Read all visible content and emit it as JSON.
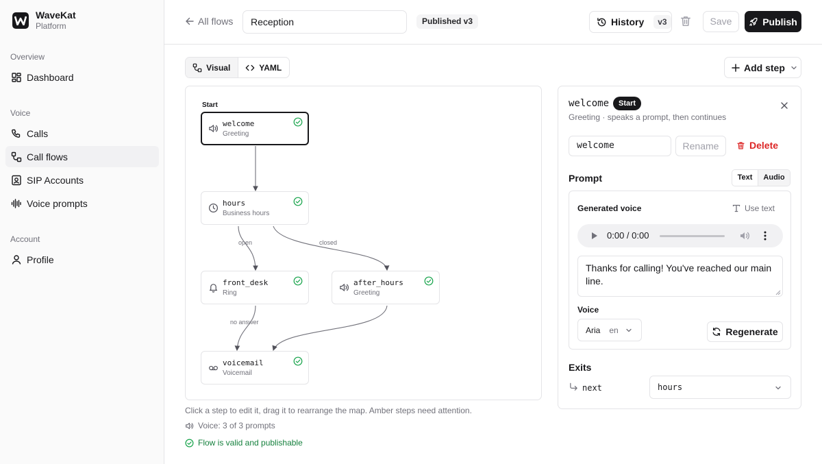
{
  "brand": {
    "name": "WaveKat",
    "sub": "Platform",
    "logo_letter": "W"
  },
  "sidebar": {
    "sections": [
      {
        "label": "Overview"
      },
      {
        "label": "Voice"
      },
      {
        "label": "Account"
      }
    ],
    "items": [
      {
        "label": "Dashboard",
        "icon": "dashboard-icon"
      },
      {
        "label": "Calls",
        "icon": "phone-icon"
      },
      {
        "label": "Call flows",
        "icon": "flow-icon",
        "active": true
      },
      {
        "label": "SIP Accounts",
        "icon": "contact-card-icon"
      },
      {
        "label": "Voice prompts",
        "icon": "audio-lines-icon"
      },
      {
        "label": "Profile",
        "icon": "user-icon"
      }
    ]
  },
  "header": {
    "back_label": "All flows",
    "flow_name": "Reception",
    "status_badge": "Published v3",
    "history_label": "History",
    "history_version": "v3",
    "save_label": "Save",
    "publish_label": "Publish"
  },
  "toolbar": {
    "tabs": [
      {
        "label": "Visual",
        "active": true
      },
      {
        "label": "YAML",
        "active": false
      }
    ],
    "add_step_label": "Add step"
  },
  "canvas": {
    "start_label": "Start",
    "nodes": [
      {
        "id": "welcome",
        "type": "Greeting",
        "icon": "speaker-icon",
        "selected": true,
        "valid": true
      },
      {
        "id": "hours",
        "type": "Business hours",
        "icon": "clock-icon",
        "valid": true
      },
      {
        "id": "front_desk",
        "type": "Ring",
        "icon": "bell-icon",
        "valid": true
      },
      {
        "id": "after_hours",
        "type": "Greeting",
        "icon": "speaker-icon",
        "valid": true
      },
      {
        "id": "voicemail",
        "type": "Voicemail",
        "icon": "voicemail-icon",
        "valid": true
      }
    ],
    "edges": [
      {
        "from": "welcome",
        "to": "hours",
        "label": ""
      },
      {
        "from": "hours",
        "to": "front_desk",
        "label": "open"
      },
      {
        "from": "hours",
        "to": "after_hours",
        "label": "closed"
      },
      {
        "from": "front_desk",
        "to": "voicemail",
        "label": "no answer"
      },
      {
        "from": "after_hours",
        "to": "voicemail",
        "label": ""
      }
    ]
  },
  "footer": {
    "help_text": "Click a step to edit it, drag it to rearrange the map. Amber steps need attention.",
    "voice_count": "Voice: 3 of 3 prompts",
    "valid_text": "Flow is valid and publishable"
  },
  "panel": {
    "step_name": "welcome",
    "start_badge": "Start",
    "subtitle": "Greeting · speaks a prompt, then continues",
    "name_value": "welcome",
    "rename_label": "Rename",
    "delete_label": "Delete",
    "prompt_label": "Prompt",
    "mode_tabs": [
      {
        "label": "Text",
        "active": false
      },
      {
        "label": "Audio",
        "active": true
      }
    ],
    "generated_voice_label": "Generated voice",
    "use_text_label": "Use text",
    "audio_time": "0:00 / 0:00",
    "prompt_text": "Thanks for calling! You've reached our main line.",
    "voice_label": "Voice",
    "voice_name": "Aria",
    "voice_lang": "en",
    "regenerate_label": "Regenerate",
    "exits_label": "Exits",
    "exits": [
      {
        "name": "next",
        "target": "hours"
      }
    ]
  },
  "colors": {
    "accent": "#18181b",
    "valid_green": "#16a34a",
    "danger": "#dc2626",
    "muted": "#71717a",
    "border": "#e4e4e7"
  }
}
